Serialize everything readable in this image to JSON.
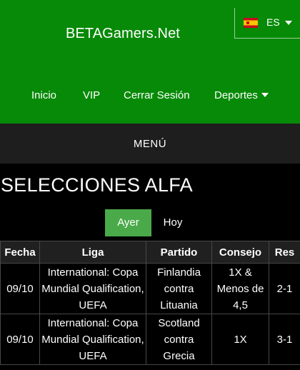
{
  "brand": "BETAGamers.Net",
  "language": {
    "code": "ES",
    "flag": "spain-flag-icon"
  },
  "nav": {
    "inicio": "Inicio",
    "vip": "VIP",
    "logout": "Cerrar Sesión",
    "deportes": "Deportes"
  },
  "menu": "MENÚ",
  "page_title": "SELECCIONES ALFA",
  "tabs": {
    "active": "Ayer",
    "other": "Hoy"
  },
  "table": {
    "headers": [
      "Fecha",
      "Liga",
      "Partido",
      "Consejo",
      "Res"
    ],
    "rows": [
      [
        "09/10",
        "International: Copa Mundial Qualification, UEFA",
        "Finlandia contra Lituania",
        "1X & Menos de 4,5",
        "2-1"
      ],
      [
        "09/10",
        "International: Copa Mundial Qualification, UEFA",
        "Scotland contra Grecia",
        "1X",
        "3-1"
      ]
    ]
  },
  "colors": {
    "header_green": "#078a07",
    "active_tab": "#4aaa4a",
    "menubar": "#1e1e1e",
    "background": "#000000"
  }
}
